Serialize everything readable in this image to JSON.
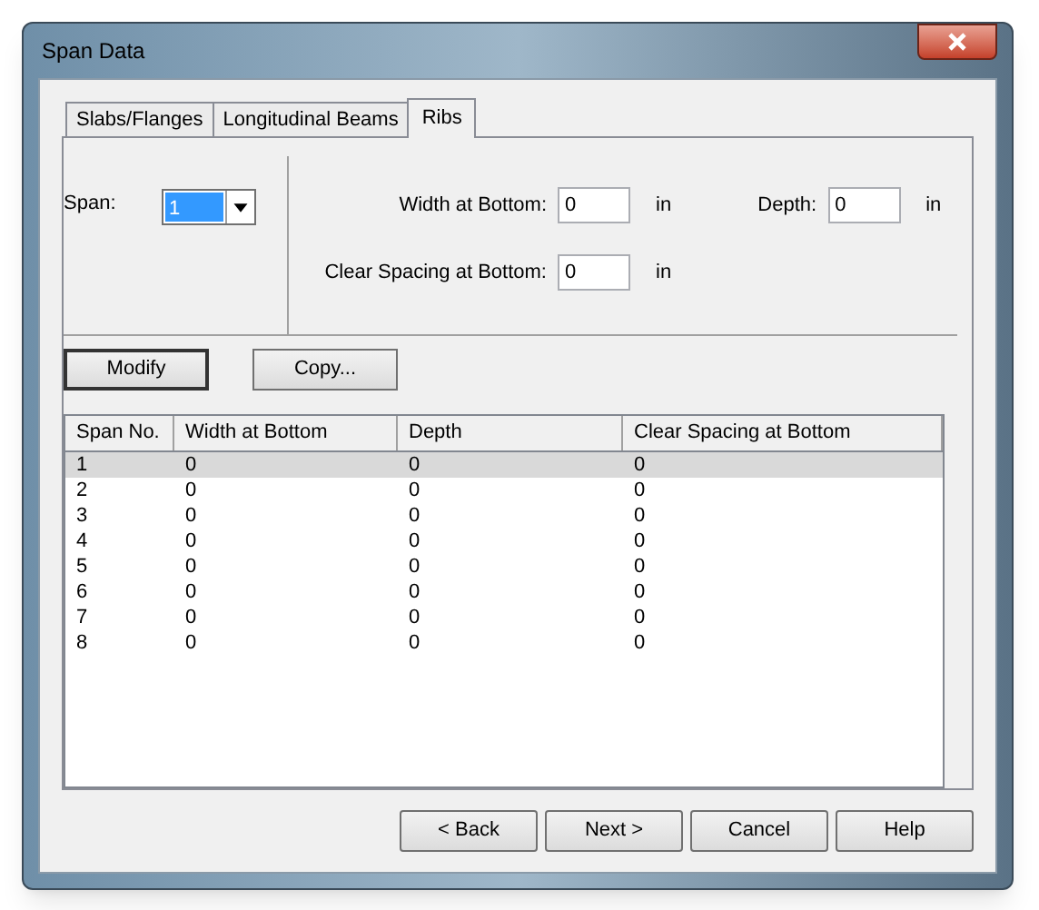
{
  "window": {
    "title": "Span Data"
  },
  "tabs": [
    {
      "label": "Slabs/Flanges",
      "selected": false
    },
    {
      "label": "Longitudinal Beams",
      "selected": false
    },
    {
      "label": "Ribs",
      "selected": true
    }
  ],
  "span": {
    "label": "Span:",
    "value": "1"
  },
  "fields": [
    {
      "label": "Width at Bottom:",
      "value": "0",
      "unit": "in"
    },
    {
      "label": "Depth:",
      "value": "0",
      "unit": "in"
    },
    {
      "label": "Clear Spacing at Bottom:",
      "value": "0",
      "unit": "in"
    }
  ],
  "actions": [
    {
      "label": "Modify",
      "default": true
    },
    {
      "label": "Copy...",
      "default": false
    }
  ],
  "table": {
    "columns": [
      "Span No.",
      "Width at Bottom",
      "Depth",
      "Clear Spacing at Bottom"
    ],
    "rows": [
      {
        "cells": [
          "1",
          "0",
          "0",
          "0"
        ],
        "selected": true
      },
      {
        "cells": [
          "2",
          "0",
          "0",
          "0"
        ],
        "selected": false
      },
      {
        "cells": [
          "3",
          "0",
          "0",
          "0"
        ],
        "selected": false
      },
      {
        "cells": [
          "4",
          "0",
          "0",
          "0"
        ],
        "selected": false
      },
      {
        "cells": [
          "5",
          "0",
          "0",
          "0"
        ],
        "selected": false
      },
      {
        "cells": [
          "6",
          "0",
          "0",
          "0"
        ],
        "selected": false
      },
      {
        "cells": [
          "7",
          "0",
          "0",
          "0"
        ],
        "selected": false
      },
      {
        "cells": [
          "8",
          "0",
          "0",
          "0"
        ],
        "selected": false
      }
    ]
  },
  "buttons": [
    "< Back",
    "Next >",
    "Cancel",
    "Help"
  ]
}
